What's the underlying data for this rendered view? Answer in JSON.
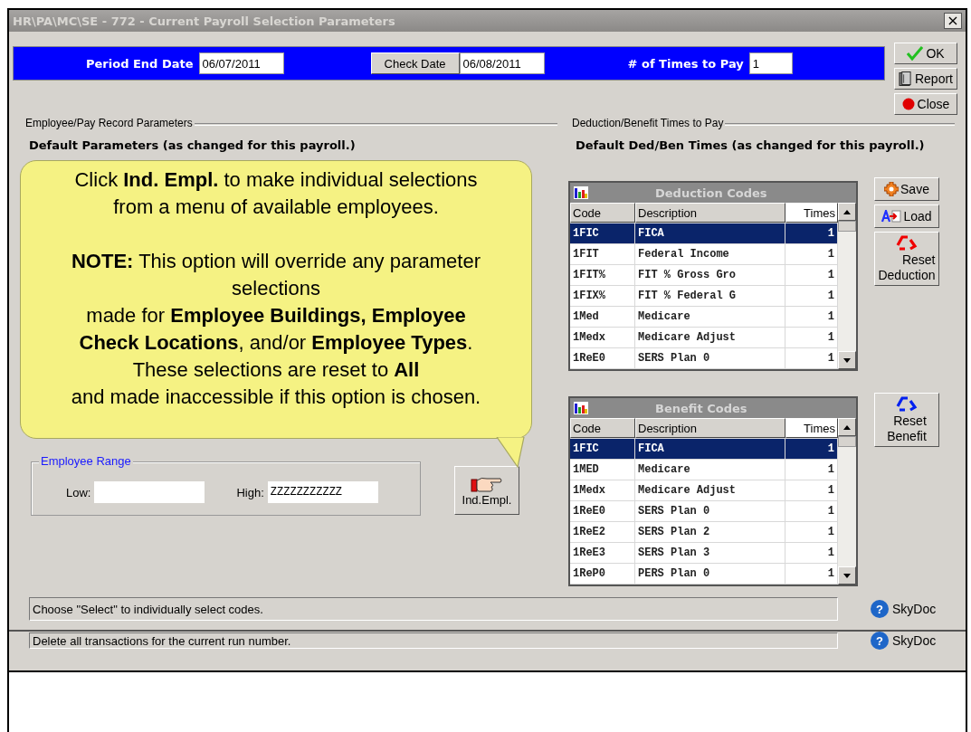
{
  "window": {
    "title": "HR\\PA\\MC\\SE - 772 - Current Payroll Selection Parameters",
    "close": "×"
  },
  "header": {
    "period_end_label": "Period End Date",
    "period_end_value": "06/07/2011",
    "check_date_button": "Check Date",
    "check_date_value": "06/08/2011",
    "times_label": "# of Times to Pay",
    "times_value": "1"
  },
  "actions": [
    {
      "kind": "ok",
      "label": "OK"
    },
    {
      "kind": "report",
      "label": "Report"
    },
    {
      "kind": "close",
      "label": "Close"
    }
  ],
  "left_group": {
    "legend": "Employee/Pay Record Parameters",
    "heading": "Default Parameters (as changed for this payroll.)"
  },
  "callout": {
    "paragraphs": [
      [
        "Click **Ind. Empl.** to make individual selections",
        "from a menu of available employees."
      ],
      [
        "**NOTE:**  This option will override any parameter",
        "selections",
        "made for **Employee Buildings, Employee**",
        "**Check Locations**, and/or **Employee Types**.",
        "These selections are reset to **All**",
        "and made inaccessible if this option is chosen."
      ]
    ]
  },
  "employee_range": {
    "legend": "Employee Range",
    "low_label": "Low:",
    "high_label": "High:",
    "high_value": "ZZZZZZZZZZZ"
  },
  "ind_empl_button": "Ind.Empl.",
  "right_group": {
    "legend": "Deduction/Benefit Times to Pay",
    "heading": "Default Ded/Ben Times (as changed for this payroll.)"
  },
  "grids": [
    {
      "title": "Deduction Codes",
      "columns": [
        "Code",
        "Description",
        "Times"
      ],
      "rows": [
        {
          "code": "1FIC",
          "description": "FICA",
          "times": "1",
          "selected": true
        },
        {
          "code": "1FIT",
          "description": "Federal Income",
          "times": "1",
          "selected": false
        },
        {
          "code": "1FIT%",
          "description": "FIT % Gross Gro",
          "times": "1",
          "selected": false
        },
        {
          "code": "1FIX%",
          "description": "FIT % Federal G",
          "times": "1",
          "selected": false
        },
        {
          "code": "1Med",
          "description": "Medicare",
          "times": "1",
          "selected": false
        },
        {
          "code": "1Medx",
          "description": "Medicare Adjust",
          "times": "1",
          "selected": false
        },
        {
          "code": "1ReE0",
          "description": "SERS Plan 0",
          "times": "1",
          "selected": false
        }
      ],
      "buttons": [
        {
          "kind": "save",
          "lines": [
            "Save"
          ]
        },
        {
          "kind": "load",
          "lines": [
            "Load"
          ]
        },
        {
          "kind": "reset-red",
          "lines": [
            "Reset",
            "Deduction"
          ]
        }
      ]
    },
    {
      "title": "Benefit Codes",
      "columns": [
        "Code",
        "Description",
        "Times"
      ],
      "rows": [
        {
          "code": "1FIC",
          "description": "FICA",
          "times": "1",
          "selected": true
        },
        {
          "code": "1MED",
          "description": "Medicare",
          "times": "1",
          "selected": false
        },
        {
          "code": "1Medx",
          "description": "Medicare Adjust",
          "times": "1",
          "selected": false
        },
        {
          "code": "1ReE0",
          "description": "SERS Plan 0",
          "times": "1",
          "selected": false
        },
        {
          "code": "1ReE2",
          "description": "SERS Plan 2",
          "times": "1",
          "selected": false
        },
        {
          "code": "1ReE3",
          "description": "SERS Plan 3",
          "times": "1",
          "selected": false
        },
        {
          "code": "1ReP0",
          "description": "PERS Plan 0",
          "times": "1",
          "selected": false
        }
      ],
      "buttons": [
        {
          "kind": "reset-blue",
          "lines": [
            "Reset",
            "Benefit"
          ]
        }
      ]
    }
  ],
  "status_bars": [
    {
      "text": "Choose \"Select\"  to individually select codes.",
      "help_glyph": "?",
      "help_label": "SkyDoc"
    },
    {
      "text": "Delete all transactions for the current run number.",
      "help_glyph": "?",
      "help_label": "SkyDoc"
    }
  ]
}
